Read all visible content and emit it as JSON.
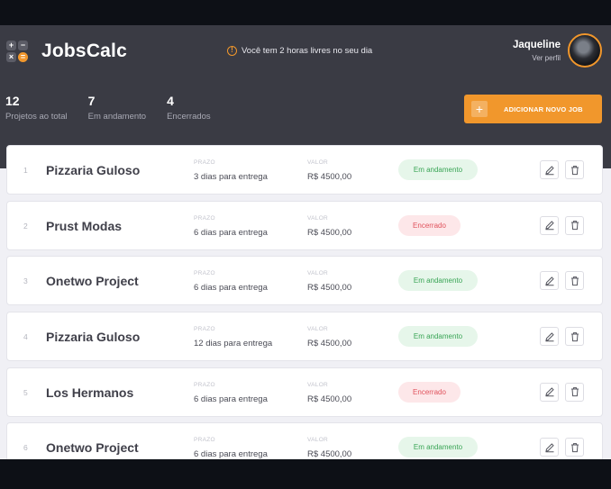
{
  "app": {
    "title": "JobsCalc",
    "notice": "Você tem 2 horas livres no seu dia"
  },
  "profile": {
    "name": "Jaqueline",
    "link": "Ver perfil"
  },
  "stats": [
    {
      "value": "12",
      "label": "Projetos ao total"
    },
    {
      "value": "7",
      "label": "Em andamento"
    },
    {
      "value": "4",
      "label": "Encerrados"
    }
  ],
  "add_button": {
    "label": "ADICIONAR NOVO JOB"
  },
  "field_labels": {
    "deadline": "PRAZO",
    "value": "VALOR"
  },
  "jobs": [
    {
      "num": "1",
      "name": "Pizzaria Guloso",
      "deadline": "3 dias para entrega",
      "value": "R$ 4500,00",
      "status": "Em andamento",
      "status_type": "progress"
    },
    {
      "num": "2",
      "name": "Prust Modas",
      "deadline": "6 dias para entrega",
      "value": "R$ 4500,00",
      "status": "Encerrado",
      "status_type": "done"
    },
    {
      "num": "3",
      "name": "Onetwo Project",
      "deadline": "6 dias para entrega",
      "value": "R$ 4500,00",
      "status": "Em andamento",
      "status_type": "progress"
    },
    {
      "num": "4",
      "name": "Pizzaria Guloso",
      "deadline": "12 dias para entrega",
      "value": "R$ 4500,00",
      "status": "Em andamento",
      "status_type": "progress"
    },
    {
      "num": "5",
      "name": "Los Hermanos",
      "deadline": "6 dias para entrega",
      "value": "R$ 4500,00",
      "status": "Encerrado",
      "status_type": "done"
    },
    {
      "num": "6",
      "name": "Onetwo Project",
      "deadline": "6 dias para entrega",
      "value": "R$ 4500,00",
      "status": "Em andamento",
      "status_type": "progress"
    }
  ],
  "colors": {
    "accent": "#f1972c",
    "header_bg": "#3a3b44",
    "progress_bg": "#e6f6ea",
    "progress_text": "#3aa556",
    "done_bg": "#fde7e9",
    "done_text": "#e0525c"
  },
  "icons": {
    "logo": "calculator-icon",
    "notice": "alert-circle-icon",
    "add": "plus-icon",
    "edit": "pencil-icon",
    "delete": "trash-icon"
  }
}
